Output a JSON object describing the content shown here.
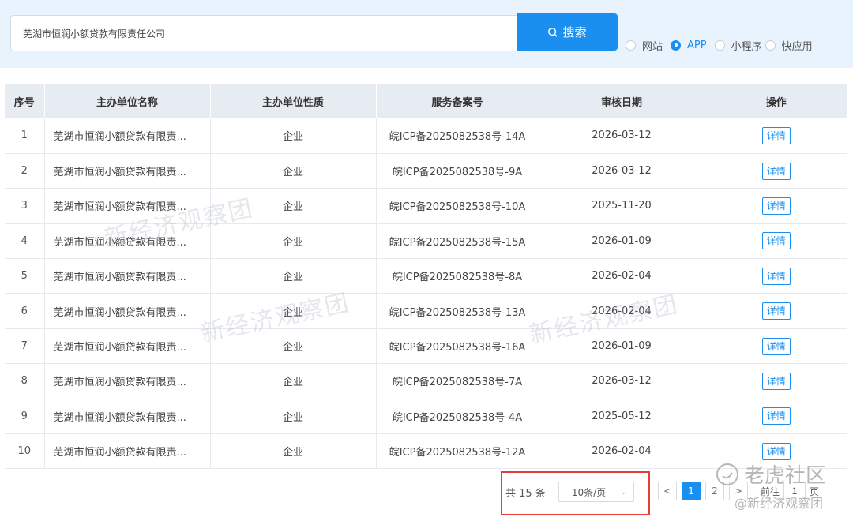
{
  "search": {
    "value": "芜湖市恒润小额贷款有限责任公司",
    "button_label": "搜索",
    "icon": "search-icon"
  },
  "filters": [
    {
      "label": "网站",
      "selected": false
    },
    {
      "label": "APP",
      "selected": true
    },
    {
      "label": "小程序",
      "selected": false
    },
    {
      "label": "快应用",
      "selected": false
    }
  ],
  "table": {
    "headers": [
      "序号",
      "主办单位名称",
      "主办单位性质",
      "服务备案号",
      "审核日期",
      "操作"
    ],
    "rows": [
      {
        "idx": "1",
        "name": "芜湖市恒润小额贷款有限责...",
        "type": "企业",
        "icp": "皖ICP备2025082538号-14A",
        "date": "2026-03-12",
        "action": "详情"
      },
      {
        "idx": "2",
        "name": "芜湖市恒润小额贷款有限责...",
        "type": "企业",
        "icp": "皖ICP备2025082538号-9A",
        "date": "2026-03-12",
        "action": "详情"
      },
      {
        "idx": "3",
        "name": "芜湖市恒润小额贷款有限责...",
        "type": "企业",
        "icp": "皖ICP备2025082538号-10A",
        "date": "2025-11-20",
        "action": "详情"
      },
      {
        "idx": "4",
        "name": "芜湖市恒润小额贷款有限责...",
        "type": "企业",
        "icp": "皖ICP备2025082538号-15A",
        "date": "2026-01-09",
        "action": "详情"
      },
      {
        "idx": "5",
        "name": "芜湖市恒润小额贷款有限责...",
        "type": "企业",
        "icp": "皖ICP备2025082538号-8A",
        "date": "2026-02-04",
        "action": "详情"
      },
      {
        "idx": "6",
        "name": "芜湖市恒润小额贷款有限责...",
        "type": "企业",
        "icp": "皖ICP备2025082538号-13A",
        "date": "2026-02-04",
        "action": "详情"
      },
      {
        "idx": "7",
        "name": "芜湖市恒润小额贷款有限责...",
        "type": "企业",
        "icp": "皖ICP备2025082538号-16A",
        "date": "2026-01-09",
        "action": "详情"
      },
      {
        "idx": "8",
        "name": "芜湖市恒润小额贷款有限责...",
        "type": "企业",
        "icp": "皖ICP备2025082538号-7A",
        "date": "2026-03-12",
        "action": "详情"
      },
      {
        "idx": "9",
        "name": "芜湖市恒润小额贷款有限责...",
        "type": "企业",
        "icp": "皖ICP备2025082538号-4A",
        "date": "2025-05-12",
        "action": "详情"
      },
      {
        "idx": "10",
        "name": "芜湖市恒润小额贷款有限责...",
        "type": "企业",
        "icp": "皖ICP备2025082538号-12A",
        "date": "2026-02-04",
        "action": "详情"
      }
    ]
  },
  "pagination": {
    "total": "共 15 条",
    "page_size": "10条/页",
    "prev": "<",
    "pages": [
      "1",
      "2"
    ],
    "current": "1",
    "next": ">",
    "goto_label": "前往",
    "goto_value": "1",
    "goto_suffix": "页"
  },
  "watermarks": {
    "text": "新经济观察团",
    "corner_brand": "老虎社区",
    "corner_handle": "@新经济观察团"
  },
  "colors": {
    "accent": "#1a8ff0",
    "highlight_border": "#e0413a",
    "header_bg": "#e8f3fd"
  }
}
